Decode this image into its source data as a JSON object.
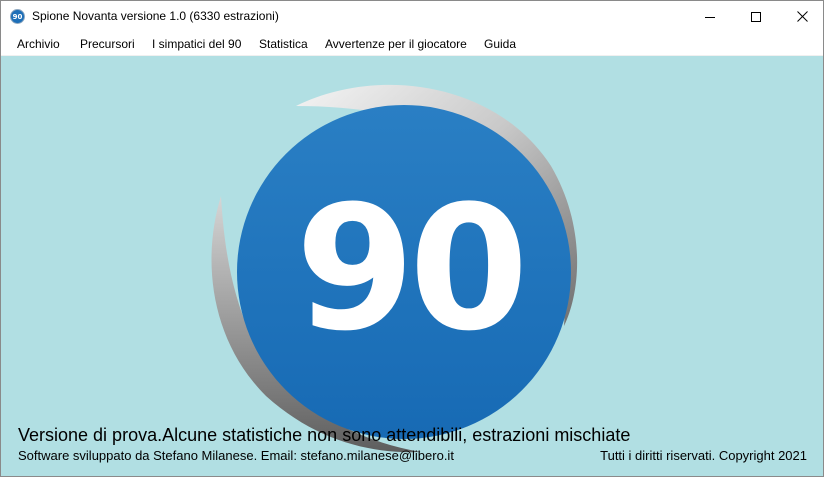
{
  "window": {
    "title": "Spione Novanta versione 1.0 (6330 estrazioni)",
    "icon": "app-90-icon",
    "icon_text": "90",
    "controls": {
      "minimize": "minimize-icon",
      "maximize": "maximize-icon",
      "close": "close-icon"
    }
  },
  "menu": {
    "items": [
      {
        "label": "Archivio"
      },
      {
        "label": "Precursori"
      },
      {
        "label": "I simpatici del 90"
      },
      {
        "label": "Statistica"
      },
      {
        "label": "Avvertenze per il giocatore"
      },
      {
        "label": "Guida"
      }
    ]
  },
  "main": {
    "logo_text": "90",
    "notice": "Versione di prova.Alcune statistiche non sono attendibili, estrazioni mischiate",
    "credits": "Software sviluppato da Stefano Milanese. Email: stefano.milanese@libero.it",
    "copyright": "Tutti i diritti riservati. Copyright 2021"
  },
  "colors": {
    "background": "#b1dfe3",
    "logo_circle": "#1d72bb",
    "logo_text": "#ffffff"
  }
}
